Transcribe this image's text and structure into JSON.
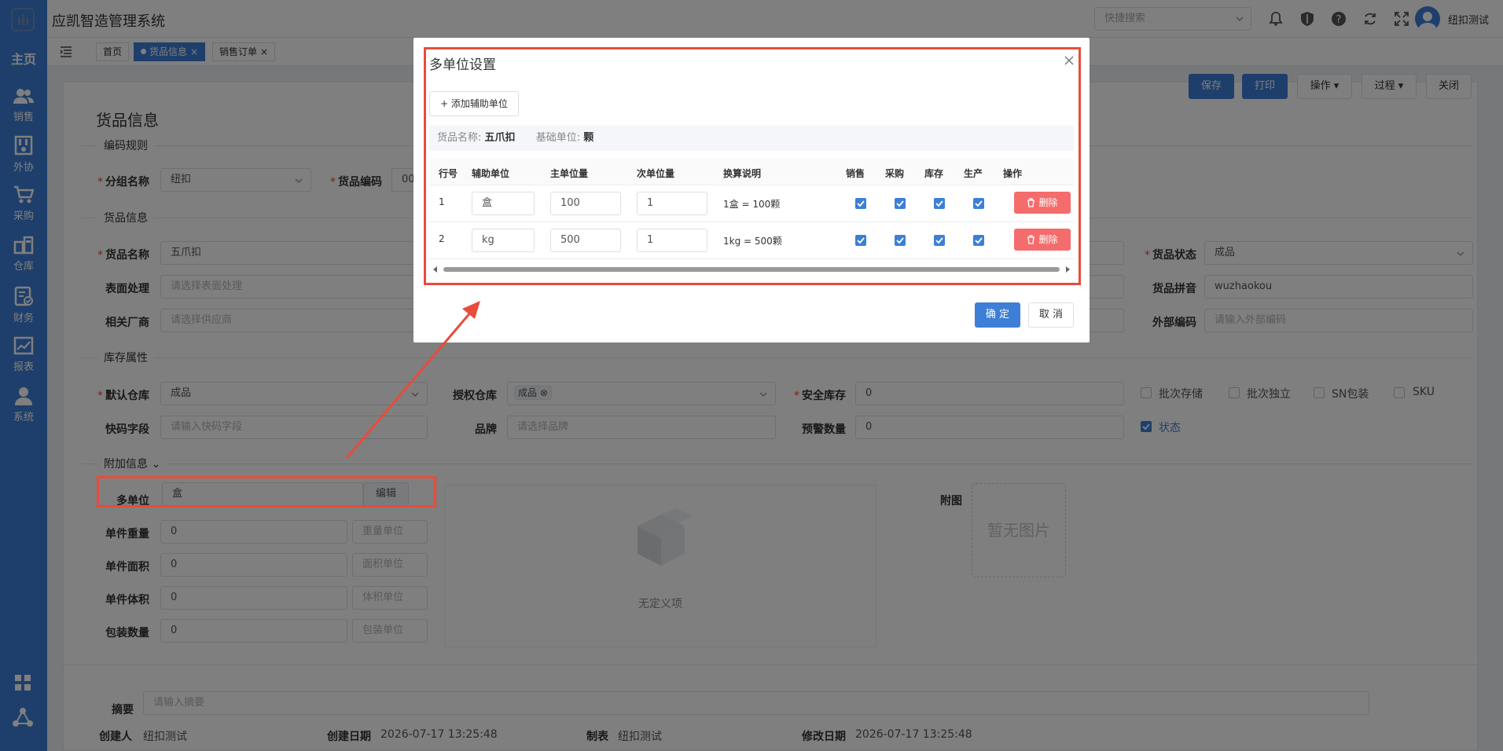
{
  "app": {
    "title": "应凯智造管理系统",
    "user": "纽扣测试"
  },
  "header": {
    "quick_search_placeholder": "快捷搜索"
  },
  "sidebar": {
    "home": "主页",
    "items": [
      {
        "label": "销售",
        "icon": "users-icon"
      },
      {
        "label": "外协",
        "icon": "factory-icon"
      },
      {
        "label": "采购",
        "icon": "cart-icon"
      },
      {
        "label": "仓库",
        "icon": "warehouse-icon"
      },
      {
        "label": "财务",
        "icon": "finance-icon"
      },
      {
        "label": "报表",
        "icon": "chart-icon"
      },
      {
        "label": "系统",
        "icon": "user-icon"
      }
    ]
  },
  "tabs": [
    {
      "label": "首页"
    },
    {
      "label": "货品信息",
      "active": true
    },
    {
      "label": "销售订单"
    }
  ],
  "toolbar": {
    "save": "保存",
    "print": "打印",
    "ops": "操作",
    "process": "过程",
    "close": "关闭"
  },
  "page": {
    "title": "货品信息"
  },
  "sections": {
    "coding": "编码规则",
    "goods": "货品信息",
    "stock": "库存属性",
    "extra": "附加信息"
  },
  "form": {
    "group_label": "分组名称",
    "group_value": "纽扣",
    "code_label": "货品编码",
    "code_value": "00",
    "name_label": "货品名称",
    "name_value": "五爪扣",
    "status_label": "货品状态",
    "status_value": "成品",
    "surface_label": "表面处理",
    "surface_ph": "请选择表面处理",
    "pinyin_label": "货品拼音",
    "pinyin_value": "wuzhaokou",
    "vendor_label": "相关厂商",
    "vendor_ph": "请选择供应商",
    "extcode_label": "外部编码",
    "extcode_ph": "请输入外部编码",
    "def_wh_label": "默认仓库",
    "def_wh_value": "成品",
    "auth_wh_label": "授权仓库",
    "auth_wh_tag": "成品",
    "safe_label": "安全库存",
    "safe_value": "0",
    "quick_label": "快码字段",
    "quick_ph": "请输入快码字段",
    "brand_label": "品牌",
    "brand_ph": "请选择品牌",
    "warn_label": "预警数量",
    "warn_value": "0",
    "batch": "批次存储",
    "batch_ind": "批次独立",
    "sn": "SN包装",
    "sku": "SKU",
    "status_chk": "状态",
    "multi_label": "多单位",
    "multi_value": "盒",
    "multi_edit": "编辑",
    "weight_label": "单件重量",
    "weight_value": "0",
    "weight_unit": "重量单位",
    "area_label": "单件面积",
    "area_value": "0",
    "area_unit": "面积单位",
    "vol_label": "单件体积",
    "vol_value": "0",
    "vol_unit": "体积单位",
    "pack_label": "包装数量",
    "pack_value": "0",
    "pack_unit": "包装单位",
    "custom_empty": "无定义项",
    "attach_label": "附图",
    "no_image": "暂无图片",
    "summary_label": "摘要",
    "summary_ph": "请输入摘要"
  },
  "meta": {
    "creator_label": "创建人",
    "creator": "纽扣测试",
    "created_label": "创建日期",
    "created": "2026-07-17 13:25:48",
    "maker_label": "制表",
    "maker": "纽扣测试",
    "modified_label": "修改日期",
    "modified": "2026-07-17 13:25:48"
  },
  "dialog": {
    "title": "多单位设置",
    "add_button": "+ 添加辅助单位",
    "goods_name_label": "货品名称:",
    "goods_name": "五爪扣",
    "base_unit_label": "基础单位:",
    "base_unit": "颗",
    "columns": [
      "行号",
      "辅助单位",
      "主单位量",
      "次单位量",
      "换算说明",
      "销售",
      "采购",
      "库存",
      "生产",
      "操作"
    ],
    "rows": [
      {
        "no": "1",
        "unit": "盒",
        "main_qty": "100",
        "sub_qty": "1",
        "desc": "1盒 = 100颗",
        "sale": true,
        "purchase": true,
        "stock": true,
        "produce": true,
        "action": "删除"
      },
      {
        "no": "2",
        "unit": "kg",
        "main_qty": "500",
        "sub_qty": "1",
        "desc": "1kg = 500颗",
        "sale": true,
        "purchase": true,
        "stock": true,
        "produce": true,
        "action": "删除"
      }
    ],
    "confirm": "确 定",
    "cancel": "取 消"
  },
  "colors": {
    "primary": "#3d7fd6",
    "danger": "#f56c6c",
    "annotation": "#e74c3c"
  }
}
